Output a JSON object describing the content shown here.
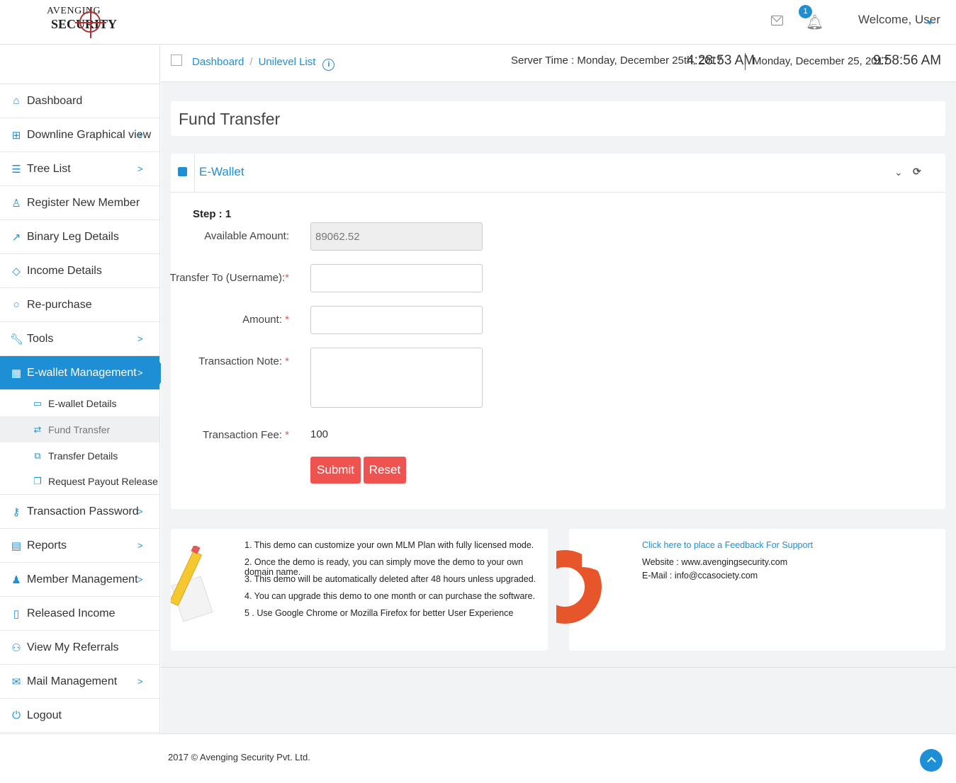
{
  "header": {
    "logo_line1": "AVENGING",
    "logo_line2": "SECURITY",
    "notification_count": "1",
    "welcome": "Welcome, User"
  },
  "sidebar": {
    "items": [
      {
        "label": "Dashboard",
        "icon": "home-icon",
        "has_children": false
      },
      {
        "label": "Downline Graphical view",
        "icon": "sitemap-icon",
        "has_children": true
      },
      {
        "label": "Tree List",
        "icon": "list-icon",
        "has_children": true
      },
      {
        "label": "Register New Member",
        "icon": "user-add-icon",
        "has_children": false
      },
      {
        "label": "Binary Leg Details",
        "icon": "line-chart-icon",
        "has_children": false
      },
      {
        "label": "Income Details",
        "icon": "tag-icon",
        "has_children": false
      },
      {
        "label": "Re-purchase",
        "icon": "circle-icon",
        "has_children": false
      },
      {
        "label": "Tools",
        "icon": "wrench-icon",
        "has_children": true
      },
      {
        "label": "E-wallet Management",
        "icon": "calendar-icon",
        "has_children": true,
        "active": true
      },
      {
        "label": "Transaction Password",
        "icon": "key-icon",
        "has_children": true
      },
      {
        "label": "Reports",
        "icon": "report-icon",
        "has_children": true
      },
      {
        "label": "Member Management",
        "icon": "users-icon",
        "has_children": true
      },
      {
        "label": "Released Income",
        "icon": "document-icon",
        "has_children": false
      },
      {
        "label": "View My Referrals",
        "icon": "referrals-icon",
        "has_children": false
      },
      {
        "label": "Mail Management",
        "icon": "chat-icon",
        "has_children": true
      },
      {
        "label": "Logout",
        "icon": "power-icon",
        "has_children": false
      }
    ],
    "ewallet_sub": [
      {
        "label": "E-wallet Details",
        "icon": "card-icon"
      },
      {
        "label": "Fund Transfer",
        "icon": "transfer-icon",
        "current": true
      },
      {
        "label": "Transfer Details",
        "icon": "copy-icon"
      },
      {
        "label": "Request Payout Release",
        "icon": "files-icon"
      }
    ]
  },
  "breadcrumb": {
    "home": "Dashboard",
    "current": "Unilevel List",
    "info": "i"
  },
  "time": {
    "server_label": "Server Time : Monday, December 25th, 2017",
    "server_time": "4:28:53 AM",
    "local_date": "Monday, December 25, 2017",
    "local_time": "9:58:56 AM"
  },
  "page": {
    "title": "Fund Transfer"
  },
  "form": {
    "panel_title": "E-Wallet",
    "step": "Step : 1",
    "available_label": "Available Amount:",
    "available_value": "89062.52",
    "transfer_to_label": "Transfer To (Username):",
    "amount_label": "Amount: ",
    "note_label": "Transaction Note: ",
    "fee_label": "Transaction Fee: ",
    "fee_value": "100",
    "required_mark": "*",
    "submit": "Submit",
    "reset": "Reset"
  },
  "notes": [
    "1. This demo can customize your own MLM Plan with fully licensed mode.",
    "2. Once the demo is ready, you can simply move the demo to your own domain name.",
    "3. This demo will be automatically deleted after 48 hours unless upgraded.",
    "4. You can upgrade this demo to one month or can purchase the software.",
    "5 . Use Google Chrome or Mozilla Firefox for better User Experience"
  ],
  "support": {
    "link": "Click here to place a Feedback For Support",
    "website": "Website : www.avengingsecurity.com",
    "email": "E-Mail : info@ccasociety.com"
  },
  "footer": {
    "copyright": "2017 © Avenging Security Pvt. Ltd."
  },
  "colors": {
    "accent": "#1e8fd5",
    "button": "#ef5350"
  }
}
